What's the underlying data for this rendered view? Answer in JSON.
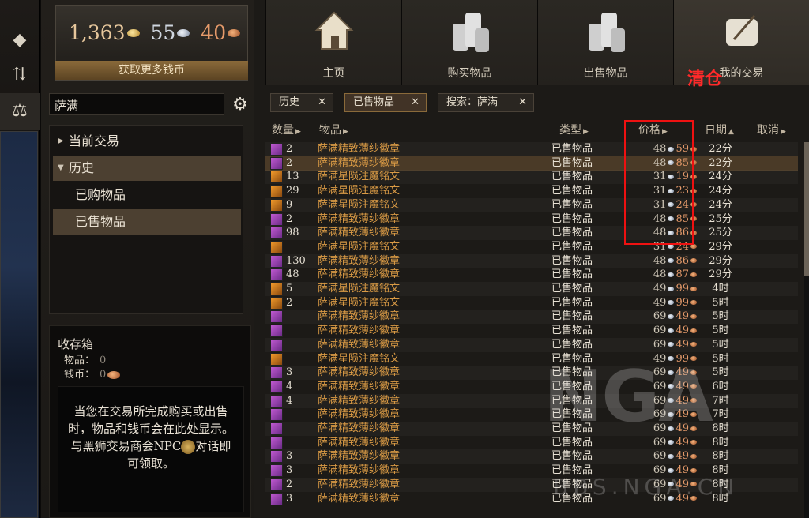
{
  "wallet": {
    "gold": "1,363",
    "silver": "55",
    "copper": "40",
    "get_more_label": "获取更多钱币"
  },
  "search": {
    "value": "萨满"
  },
  "nav": {
    "current": "当前交易",
    "history": "历史",
    "bought": "已购物品",
    "sold": "已售物品"
  },
  "collection": {
    "title": "收存箱",
    "items_label": "物品：",
    "items_value": "0",
    "coins_label": "钱币：",
    "coins_value": "0",
    "info_text_1": "当您在交易所完成购买或出售时，物品和钱币会在此处显示。与黑狮交易商会NPC",
    "info_text_2": "对话即可领取。"
  },
  "top_tabs": {
    "home": "主页",
    "buy": "购买物品",
    "sell": "出售物品",
    "my_trades": "我的交易",
    "overlay": "清仓"
  },
  "filters": {
    "history": "历史",
    "sold": "已售物品",
    "search": "搜索：萨满"
  },
  "table_headers": {
    "qty": "数量",
    "item": "物品",
    "type": "类型",
    "price": "价格",
    "date": "日期",
    "cancel": "取消"
  },
  "rows": [
    {
      "icon": "emblem",
      "qty": "2",
      "item": "萨满精致薄纱徽章",
      "type": "已售物品",
      "silver": "48",
      "copper": "59",
      "date": "22分"
    },
    {
      "icon": "emblem",
      "qty": "2",
      "item": "萨满精致薄纱徽章",
      "type": "已售物品",
      "silver": "48",
      "copper": "85",
      "date": "22分"
    },
    {
      "icon": "inscription",
      "qty": "13",
      "item": "萨满星陨注魔铭文",
      "type": "已售物品",
      "silver": "31",
      "copper": "19",
      "date": "24分"
    },
    {
      "icon": "inscription",
      "qty": "29",
      "item": "萨满星陨注魔铭文",
      "type": "已售物品",
      "silver": "31",
      "copper": "23",
      "date": "24分"
    },
    {
      "icon": "inscription",
      "qty": "9",
      "item": "萨满星陨注魔铭文",
      "type": "已售物品",
      "silver": "31",
      "copper": "24",
      "date": "24分"
    },
    {
      "icon": "emblem",
      "qty": "2",
      "item": "萨满精致薄纱徽章",
      "type": "已售物品",
      "silver": "48",
      "copper": "85",
      "date": "25分"
    },
    {
      "icon": "emblem",
      "qty": "98",
      "item": "萨满精致薄纱徽章",
      "type": "已售物品",
      "silver": "48",
      "copper": "86",
      "date": "25分"
    },
    {
      "icon": "inscription",
      "qty": "",
      "item": "萨满星陨注魔铭文",
      "type": "已售物品",
      "silver": "31",
      "copper": "24",
      "date": "29分"
    },
    {
      "icon": "emblem",
      "qty": "130",
      "item": "萨满精致薄纱徽章",
      "type": "已售物品",
      "silver": "48",
      "copper": "86",
      "date": "29分"
    },
    {
      "icon": "emblem",
      "qty": "48",
      "item": "萨满精致薄纱徽章",
      "type": "已售物品",
      "silver": "48",
      "copper": "87",
      "date": "29分"
    },
    {
      "icon": "inscription",
      "qty": "5",
      "item": "萨满星陨注魔铭文",
      "type": "已售物品",
      "silver": "49",
      "copper": "99",
      "date": "4时"
    },
    {
      "icon": "inscription",
      "qty": "2",
      "item": "萨满星陨注魔铭文",
      "type": "已售物品",
      "silver": "49",
      "copper": "99",
      "date": "5时"
    },
    {
      "icon": "emblem",
      "qty": "",
      "item": "萨满精致薄纱徽章",
      "type": "已售物品",
      "silver": "69",
      "copper": "49",
      "date": "5时"
    },
    {
      "icon": "emblem",
      "qty": "",
      "item": "萨满精致薄纱徽章",
      "type": "已售物品",
      "silver": "69",
      "copper": "49",
      "date": "5时"
    },
    {
      "icon": "emblem",
      "qty": "",
      "item": "萨满精致薄纱徽章",
      "type": "已售物品",
      "silver": "69",
      "copper": "49",
      "date": "5时"
    },
    {
      "icon": "inscription",
      "qty": "",
      "item": "萨满星陨注魔铭文",
      "type": "已售物品",
      "silver": "49",
      "copper": "99",
      "date": "5时"
    },
    {
      "icon": "emblem",
      "qty": "3",
      "item": "萨满精致薄纱徽章",
      "type": "已售物品",
      "silver": "69",
      "copper": "49",
      "date": "5时"
    },
    {
      "icon": "emblem",
      "qty": "4",
      "item": "萨满精致薄纱徽章",
      "type": "已售物品",
      "silver": "69",
      "copper": "49",
      "date": "6时"
    },
    {
      "icon": "emblem",
      "qty": "4",
      "item": "萨满精致薄纱徽章",
      "type": "已售物品",
      "silver": "69",
      "copper": "49",
      "date": "7时"
    },
    {
      "icon": "emblem",
      "qty": "",
      "item": "萨满精致薄纱徽章",
      "type": "已售物品",
      "silver": "69",
      "copper": "49",
      "date": "7时"
    },
    {
      "icon": "emblem",
      "qty": "",
      "item": "萨满精致薄纱徽章",
      "type": "已售物品",
      "silver": "69",
      "copper": "49",
      "date": "8时"
    },
    {
      "icon": "emblem",
      "qty": "",
      "item": "萨满精致薄纱徽章",
      "type": "已售物品",
      "silver": "69",
      "copper": "49",
      "date": "8时"
    },
    {
      "icon": "emblem",
      "qty": "3",
      "item": "萨满精致薄纱徽章",
      "type": "已售物品",
      "silver": "69",
      "copper": "49",
      "date": "8时"
    },
    {
      "icon": "emblem",
      "qty": "3",
      "item": "萨满精致薄纱徽章",
      "type": "已售物品",
      "silver": "69",
      "copper": "49",
      "date": "8时"
    },
    {
      "icon": "emblem",
      "qty": "2",
      "item": "萨满精致薄纱徽章",
      "type": "已售物品",
      "silver": "69",
      "copper": "49",
      "date": "8时"
    },
    {
      "icon": "emblem",
      "qty": "3",
      "item": "萨满精致薄纱徽章",
      "type": "已售物品",
      "silver": "69",
      "copper": "49",
      "date": "8时"
    }
  ],
  "watermark": "NGA",
  "watermark_url": "BBS.NGA.CN"
}
